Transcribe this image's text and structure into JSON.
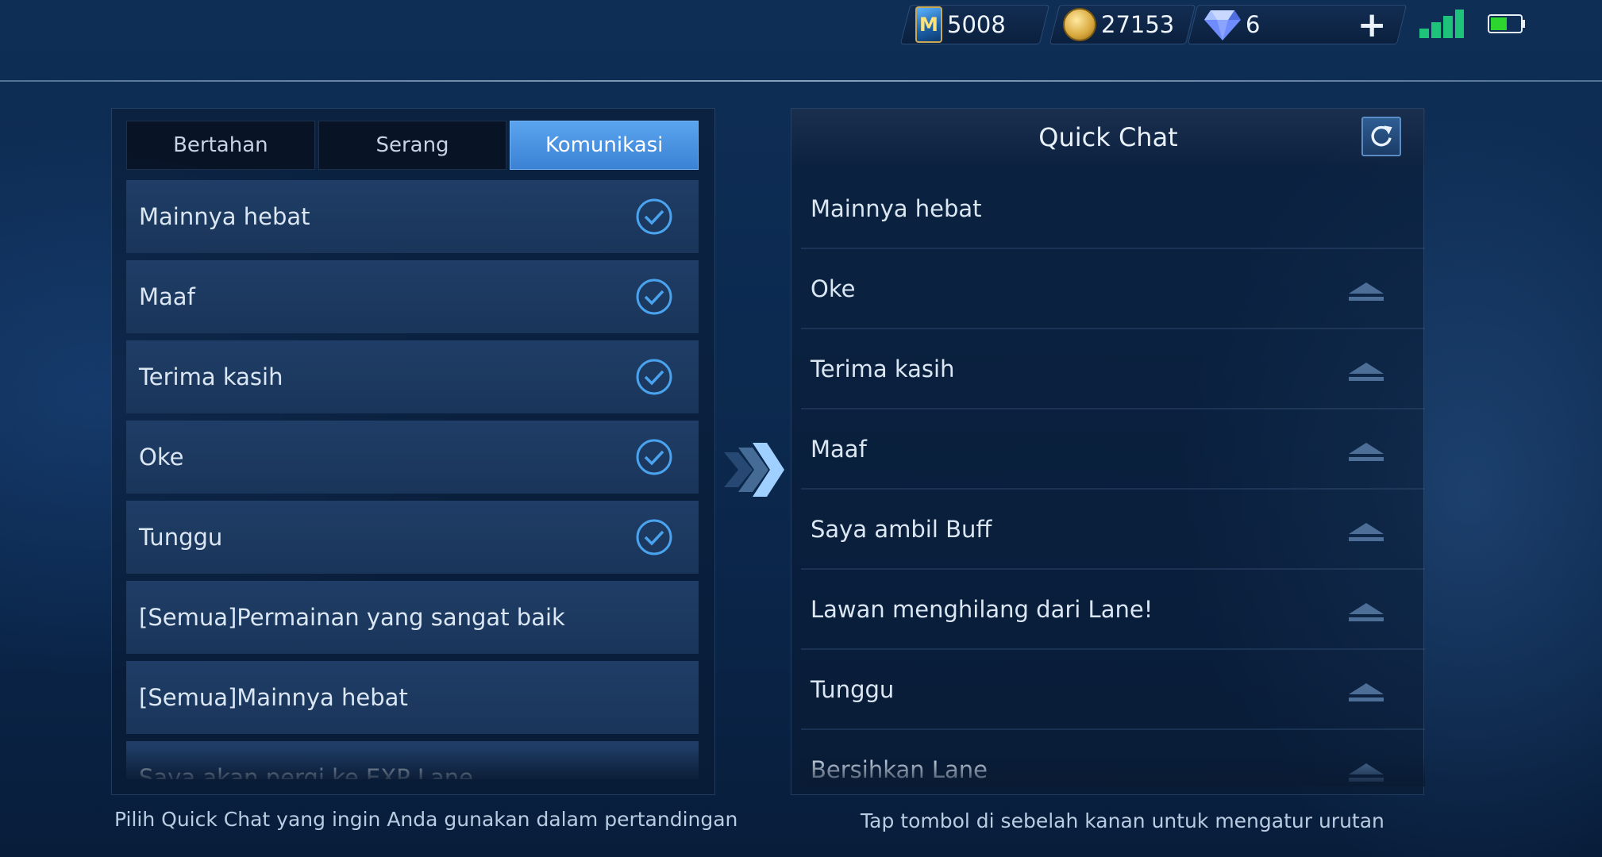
{
  "currency": {
    "ticket": "5008",
    "gold": "27153",
    "diamond": "6"
  },
  "tabs": [
    {
      "label": "Bertahan",
      "active": false
    },
    {
      "label": "Serang",
      "active": false
    },
    {
      "label": "Komunikasi",
      "active": true
    }
  ],
  "options": [
    {
      "label": "Mainnya hebat",
      "selected": true
    },
    {
      "label": "Maaf",
      "selected": true
    },
    {
      "label": "Terima kasih",
      "selected": true
    },
    {
      "label": "Oke",
      "selected": true
    },
    {
      "label": "Tunggu",
      "selected": true
    },
    {
      "label": "[Semua]Permainan yang sangat baik",
      "selected": false
    },
    {
      "label": "[Semua]Mainnya hebat",
      "selected": false
    },
    {
      "label": "Saya akan pergi ke EXP Lane",
      "selected": false
    }
  ],
  "quick_chat": {
    "title": "Quick Chat",
    "items": [
      {
        "label": "Mainnya hebat",
        "movable": false
      },
      {
        "label": "Oke",
        "movable": true
      },
      {
        "label": "Terima kasih",
        "movable": true
      },
      {
        "label": "Maaf",
        "movable": true
      },
      {
        "label": "Saya ambil Buff",
        "movable": true
      },
      {
        "label": "Lawan menghilang dari Lane!",
        "movable": true
      },
      {
        "label": "Tunggu",
        "movable": true
      },
      {
        "label": "Bersihkan Lane",
        "movable": true
      }
    ]
  },
  "hints": {
    "left": "Pilih Quick Chat yang ingin Anda gunakan dalam pertandingan",
    "right": "Tap tombol di sebelah kanan untuk mengatur urutan"
  },
  "colors": {
    "accent": "#3f8ee0",
    "check": "#4aa3ee",
    "tab_active": "#4a93e3",
    "signal": "#1fc27a",
    "battery": "#2ed52e"
  }
}
